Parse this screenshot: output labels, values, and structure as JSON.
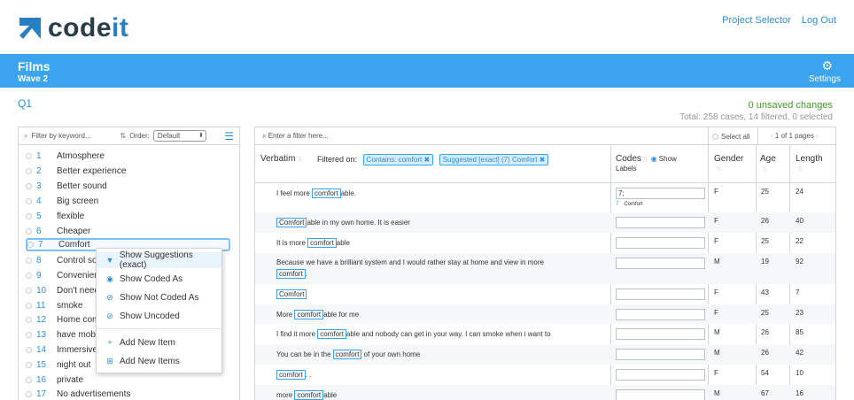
{
  "app": {
    "logo_text_a": "code",
    "logo_text_b": "it",
    "links": [
      "Project Selector",
      "Log Out"
    ]
  },
  "banner": {
    "title": "Films",
    "subtitle": "Wave 2",
    "settings": "Settings"
  },
  "question": "Q1",
  "status": {
    "unsaved": "0 unsaved changes",
    "total": "Total: 258 cases, 14 filtered, 0 selected"
  },
  "left_panel": {
    "filter_placeholder": "Filter by keyword...",
    "order_label": "Order:",
    "order_value": "Default",
    "items": [
      {
        "num": "1",
        "label": "Atmosphere"
      },
      {
        "num": "2",
        "label": "Better experience"
      },
      {
        "num": "3",
        "label": "Better sound"
      },
      {
        "num": "4",
        "label": "Big screen"
      },
      {
        "num": "5",
        "label": "flexible"
      },
      {
        "num": "6",
        "label": "Cheaper"
      },
      {
        "num": "7",
        "label": "Comfort"
      },
      {
        "num": "8",
        "label": "Control so"
      },
      {
        "num": "9",
        "label": "Convenien"
      },
      {
        "num": "10",
        "label": "Don't need"
      },
      {
        "num": "11",
        "label": "smoke"
      },
      {
        "num": "12",
        "label": "Home com"
      },
      {
        "num": "13",
        "label": "have mobi"
      },
      {
        "num": "14",
        "label": "Immersive"
      },
      {
        "num": "15",
        "label": "night out"
      },
      {
        "num": "16",
        "label": "private"
      },
      {
        "num": "17",
        "label": "No advertisements"
      }
    ]
  },
  "context_menu": {
    "items": [
      "Show Suggestions (exact)",
      "Show Coded As",
      "Show Not Coded As",
      "Show Uncoded",
      "Add New Item",
      "Add New Items"
    ]
  },
  "right_panel": {
    "filter_placeholder": "Enter a filter here...",
    "select_all": "Select all",
    "pages": "1 of 1 pages",
    "headers": {
      "verbatim": "Verbatim",
      "filtered_on": "Filtered on:",
      "chip1": "Contains: comfort",
      "chip2": "Suggested [exact] (7) Comfort",
      "codes": "Codes",
      "show": "Show",
      "labels": "Labels",
      "gender": "Gender",
      "age": "Age",
      "length": "Length"
    },
    "rows": [
      {
        "pre": "I feel more ",
        "kw": "comfort",
        "post": "able.",
        "codes": "7;",
        "code_num": "7",
        "code_label": "Comfort",
        "gender": "F",
        "age": "25",
        "length": "24"
      },
      {
        "pre": "",
        "kw": "Comfort",
        "post": "able in my own home. It is easier",
        "codes": "",
        "gender": "F",
        "age": "26",
        "length": "40"
      },
      {
        "pre": "It is more ",
        "kw": "comfort",
        "post": "able",
        "codes": "",
        "gender": "F",
        "age": "25",
        "length": "22"
      },
      {
        "pre": "Because we have a brilliant system and I would rather stay at home and view in more",
        "kw": "comfort",
        "post": ".",
        "codes": "",
        "gender": "M",
        "age": "19",
        "length": "92"
      },
      {
        "pre": "",
        "kw": "Comfort",
        "post": "",
        "codes": "",
        "gender": "F",
        "age": "43",
        "length": "7"
      },
      {
        "pre": "More ",
        "kw": "comfort",
        "post": "able for me",
        "codes": "",
        "gender": "F",
        "age": "25",
        "length": "23"
      },
      {
        "pre": "I find it more ",
        "kw": "comfort",
        "post": "able and nobody can get in your way. I can smoke when i want to",
        "codes": "",
        "gender": "M",
        "age": "26",
        "length": "85"
      },
      {
        "pre": "You can be in the ",
        "kw": "comfort",
        "post": " of your own home",
        "codes": "",
        "gender": "M",
        "age": "26",
        "length": "42"
      },
      {
        "pre": "",
        "kw": "comfort",
        "post": ". .",
        "codes": "",
        "gender": "F",
        "age": "54",
        "length": "10"
      },
      {
        "pre": "more ",
        "kw": "comfort",
        "post": "able",
        "codes": "",
        "gender": "M",
        "age": "67",
        "length": "16"
      }
    ]
  },
  "colors": {
    "accent": "#3aa4ee",
    "link": "#2a8fd8",
    "saved": "#3f9a1f"
  }
}
